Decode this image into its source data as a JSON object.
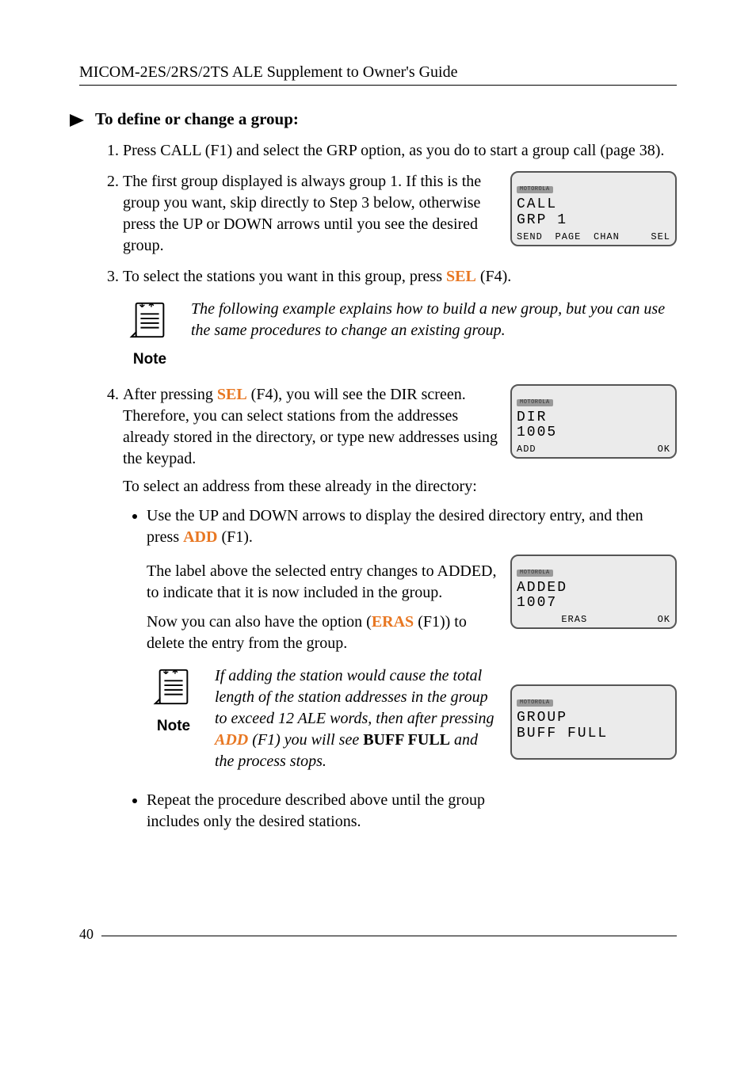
{
  "header": "MICOM-2ES/2RS/2TS ALE Supplement to Owner's Guide",
  "proc_heading": "To define or change a group:",
  "steps": {
    "s1": {
      "text_a": "Press CALL (F1) and select the GRP option, as you do to start a group call (page 38)."
    },
    "s2": {
      "text_a": "The first group displayed is always group 1. If this is the group you want, skip directly to Step 3 below, otherwise press the UP or DOWN arrows until you see the desired group."
    },
    "s3": {
      "text_a": "To select the stations you want in this group, press ",
      "sel": "SEL",
      "text_b": " (F4)."
    },
    "s4": {
      "text_a": "After pressing ",
      "sel": "SEL",
      "text_b": " (F4), you will see the DIR screen. Therefore, you can select stations from the addresses already stored in the directory, or type new addresses using the keypad.",
      "para2": "To select an address from these already in the directory:",
      "bullet1_a": "Use the UP and DOWN arrows to display the desired directory entry, and then press ",
      "add": "ADD",
      "bullet1_b": " (F1).",
      "sub1": "The label above the selected entry changes to ADDED, to indicate that it is now included in the group.",
      "sub2_a": "Now you can also have the option (",
      "eras": "ERAS",
      "sub2_b": " (F1)) to delete the entry from the group.",
      "bullet2": "Repeat the procedure described above until the group includes only the desired stations."
    }
  },
  "note1": {
    "label": "Note",
    "text": "The following example explains how to build a new group, but you can use the same procedures to change an existing group."
  },
  "note2": {
    "label": "Note",
    "text_a": "If adding the station would cause the total length of the station addresses in the group to exceed 12 ALE words, then after pressing ",
    "add": "ADD",
    "text_b": " (F1) you will see ",
    "buff": "BUFF FULL",
    "text_c": " and the process stops."
  },
  "lcd": {
    "brand": "MOTOROLA",
    "screen1": {
      "l1": "CALL",
      "l2": "GRP 1",
      "sk": [
        "SEND",
        "PAGE",
        "CHAN",
        "SEL"
      ]
    },
    "screen2": {
      "l1": "DIR",
      "l2": "1005",
      "sk": [
        "ADD",
        "",
        "",
        "OK"
      ]
    },
    "screen3": {
      "l1": "ADDED",
      "l2": "1007",
      "sk": [
        "",
        "ERAS",
        "",
        "OK"
      ]
    },
    "screen4": {
      "l1": "GROUP",
      "l2": "BUFF FULL",
      "sk": [
        "",
        "",
        "",
        ""
      ]
    }
  },
  "page_number": "40"
}
